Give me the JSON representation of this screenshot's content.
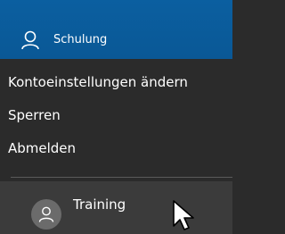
{
  "current_account": {
    "name": "Schulung",
    "icon": "person-outline-icon"
  },
  "menu": {
    "items": [
      {
        "label": "Kontoeinstellungen ändern"
      },
      {
        "label": "Sperren"
      },
      {
        "label": "Abmelden"
      }
    ]
  },
  "other_account": {
    "name": "Training",
    "icon": "person-outline-icon"
  },
  "colors": {
    "header_bg": "#0a5a9a",
    "menu_bg": "#2b2b2b",
    "other_account_bg": "#3b3b3b",
    "text": "#ffffff"
  },
  "cursor": "arrow-cursor-icon"
}
